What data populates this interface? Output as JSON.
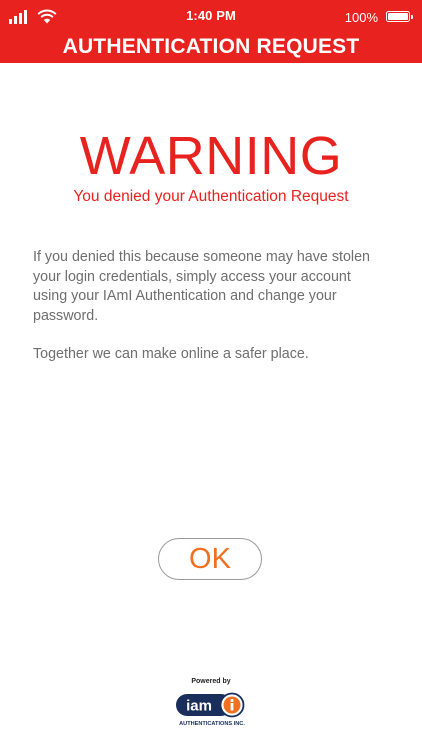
{
  "status_bar": {
    "time": "1:40 PM",
    "battery": "100%",
    "signal_icon": "cellular-signal-icon",
    "wifi_icon": "wifi-icon",
    "battery_icon": "battery-icon"
  },
  "header": {
    "title": "AUTHENTICATION REQUEST",
    "background": "#e8221e"
  },
  "main": {
    "warning": "WARNING",
    "subtitle": "You denied your Authentication Request",
    "paragraph1": "If you denied this because someone may have stolen your login credentials, simply access your account using your IAmI Authentication and change your password.",
    "paragraph2": "Together we can make online a safer place.",
    "accent_color": "#e8221e",
    "text_color": "#6e6e6e"
  },
  "ok_button": {
    "label": "OK",
    "color": "#f07020"
  },
  "footer": {
    "powered_by": "Powered by",
    "logo_text": "iam",
    "logo_tagline": "AUTHENTICATIONS INC.",
    "logo_color": "#1a2e5c"
  }
}
